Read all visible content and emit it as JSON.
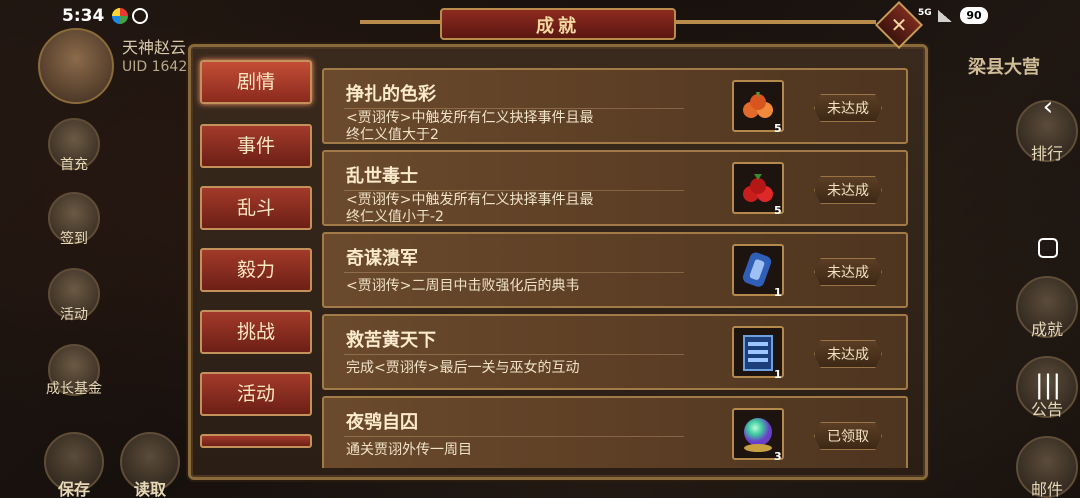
{
  "status_bar": {
    "time": "5:34",
    "network": "5G",
    "battery": "90"
  },
  "player": {
    "name": "天神赵云",
    "uid": "UID  1642"
  },
  "location": "梁县大营",
  "left_menu": [
    "首充",
    "签到",
    "活动",
    "成长基金"
  ],
  "bottom_menu": [
    "保存",
    "读取"
  ],
  "right_menu": [
    "排行",
    "成就",
    "公告",
    "邮件"
  ],
  "panel": {
    "title": "成就",
    "close_label": "✕",
    "tabs": [
      "剧情",
      "事件",
      "乱斗",
      "毅力",
      "挑战",
      "活动"
    ],
    "active_tab": "剧情",
    "achievements": [
      {
        "title": "挣扎的色彩",
        "desc_line1": "<贾诩传>中触发所有仁义抉择事件且最",
        "desc_line2": "终仁义值大于2",
        "count": "5",
        "status": "未达成",
        "icon": "red-fruit-icon"
      },
      {
        "title": "乱世毒士",
        "desc_line1": "<贾诩传>中触发所有仁义抉择事件且最",
        "desc_line2": "终仁义值小于-2",
        "count": "5",
        "status": "未达成",
        "icon": "cherry-icon"
      },
      {
        "title": "奇谋溃军",
        "desc_line1": "<贾诩传>二周目中击败强化后的典韦",
        "desc_line2": "",
        "count": "1",
        "status": "未达成",
        "icon": "scroll-icon"
      },
      {
        "title": "救苦黄天下",
        "desc_line1": "完成<贾诩传>最后一关与巫女的互动",
        "desc_line2": "",
        "count": "1",
        "status": "未达成",
        "icon": "book-icon"
      },
      {
        "title": "夜鸮自囚",
        "desc_line1": "通关贾诩外传一周目",
        "desc_line2": "",
        "count": "3",
        "status": "已领取",
        "icon": "orb-icon"
      }
    ]
  }
}
